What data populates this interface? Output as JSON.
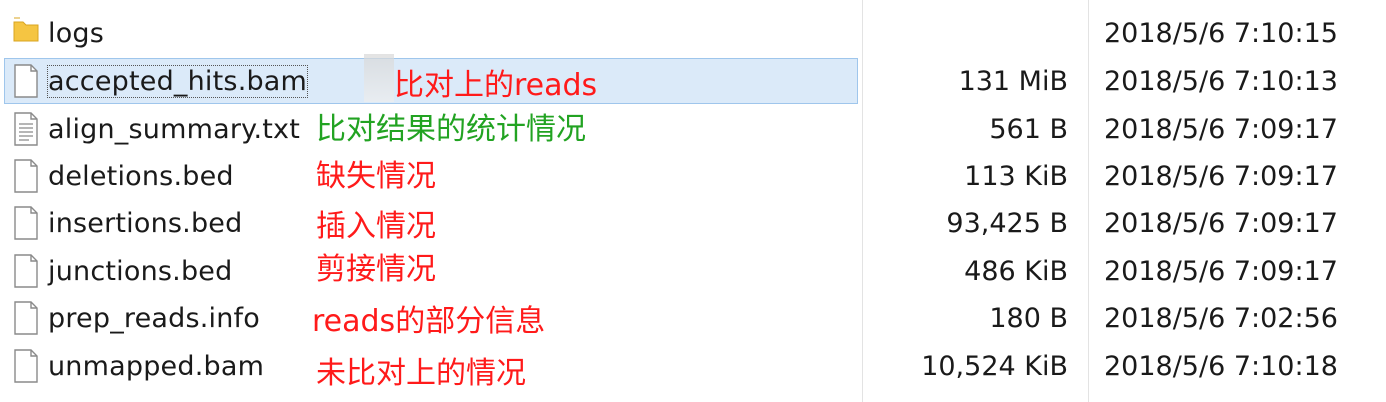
{
  "colors": {
    "red_note": "#ff1a1a",
    "green_note": "#22a322",
    "selection_bg": "#dbeaf9",
    "selection_border": "#9fc6ec",
    "folder": "#f5c542"
  },
  "files": [
    {
      "name": "logs",
      "icon": "folder-icon",
      "size": "",
      "date": "2018/5/6 7:10:15",
      "note": ""
    },
    {
      "name": "accepted_hits.bam",
      "icon": "file-icon",
      "size": "131 MiB",
      "date": "2018/5/6 7:10:13",
      "note": "比对上的reads",
      "note_color": "red",
      "selected": true
    },
    {
      "name": "align_summary.txt",
      "icon": "text-file-icon",
      "size": "561 B",
      "date": "2018/5/6 7:09:17",
      "note": "比对结果的统计情况",
      "note_color": "green"
    },
    {
      "name": "deletions.bed",
      "icon": "file-icon",
      "size": "113 KiB",
      "date": "2018/5/6 7:09:17",
      "note": "缺失情况",
      "note_color": "red"
    },
    {
      "name": "insertions.bed",
      "icon": "file-icon",
      "size": "93,425 B",
      "date": "2018/5/6 7:09:17",
      "note": "插入情况",
      "note_color": "red"
    },
    {
      "name": "junctions.bed",
      "icon": "file-icon",
      "size": "486 KiB",
      "date": "2018/5/6 7:09:17",
      "note": "剪接情况",
      "note_color": "red"
    },
    {
      "name": "prep_reads.info",
      "icon": "file-icon",
      "size": "180 B",
      "date": "2018/5/6 7:02:56",
      "note": "reads的部分信息",
      "note_color": "red"
    },
    {
      "name": "unmapped.bam",
      "icon": "file-icon",
      "size": "10,524 KiB",
      "date": "2018/5/6 7:10:18",
      "note": "未比对上的情况",
      "note_color": "red"
    }
  ]
}
